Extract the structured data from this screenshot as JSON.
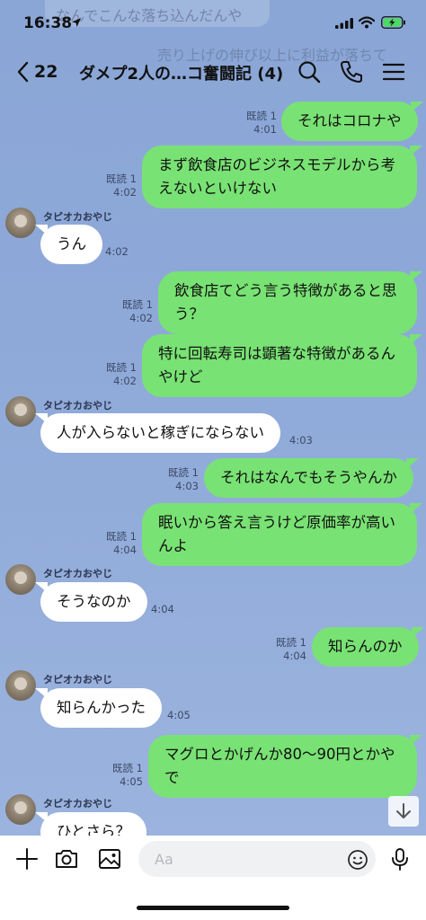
{
  "status": {
    "time": "16:38"
  },
  "banner": {
    "line1": "なんでこんな落ち込んだんや",
    "line2": "売り上げの伸び以上に利益が落ちて"
  },
  "header": {
    "back_count": "22",
    "title": "ダメプ2人の…コ奮闘記 (4)"
  },
  "messages": [
    {
      "dir": "out",
      "lines": [
        "それはコロナや"
      ],
      "read": "既読 1",
      "time": "4:01"
    },
    {
      "dir": "out",
      "lines": [
        "まず飲食店のビジネスモデルから考",
        "えないといけない"
      ],
      "read": "既読 1",
      "time": "4:02"
    },
    {
      "dir": "in",
      "sender": "タピオカおやじ",
      "lines": [
        "うん"
      ],
      "time": "4:02"
    },
    {
      "dir": "out",
      "lines": [
        "飲食店てどう言う特徴があると思",
        "う？"
      ],
      "read": "既読 1",
      "time": "4:02"
    },
    {
      "dir": "out",
      "lines": [
        "特に回転寿司は顕著な特徴があるん",
        "やけど"
      ],
      "read": "既読 1",
      "time": "4:02"
    },
    {
      "dir": "in",
      "sender": "タピオカおやじ",
      "lines": [
        "人が入らないと稼ぎにならない"
      ],
      "time": "4:03"
    },
    {
      "dir": "out",
      "lines": [
        "それはなんでもそうやんか"
      ],
      "read": "既読 1",
      "time": "4:03"
    },
    {
      "dir": "out",
      "lines": [
        "眠いから答え言うけど原価率が高い",
        "んよ"
      ],
      "read": "既読 1",
      "time": "4:04"
    },
    {
      "dir": "in",
      "sender": "タピオカおやじ",
      "lines": [
        "そうなのか"
      ],
      "time": "4:04"
    },
    {
      "dir": "out",
      "lines": [
        "知らんのか"
      ],
      "read": "既読 1",
      "time": "4:04"
    },
    {
      "dir": "in",
      "sender": "タピオカおやじ",
      "lines": [
        "知らんかった"
      ],
      "time": "4:05"
    },
    {
      "dir": "out",
      "lines": [
        "マグロとかげんか80〜90円とかや",
        "で"
      ],
      "read": "既読 1",
      "time": "4:05"
    },
    {
      "dir": "in",
      "sender": "タピオカおやじ",
      "lines": [
        "ひとさら？"
      ],
      "time": ""
    }
  ],
  "input": {
    "placeholder": "Aa"
  },
  "icons": {
    "back": "chevron-left-icon",
    "search": "search-icon",
    "call": "phone-icon",
    "menu": "menu-icon",
    "add": "plus-icon",
    "camera": "camera-icon",
    "image": "image-icon",
    "emoji": "emoji-icon",
    "mic": "microphone-icon",
    "scroll": "arrow-down-icon"
  },
  "colors": {
    "chat_bg": "#8ea9d8",
    "outgoing": "#79e274",
    "incoming": "#ffffff",
    "battery": "#4cd964"
  }
}
